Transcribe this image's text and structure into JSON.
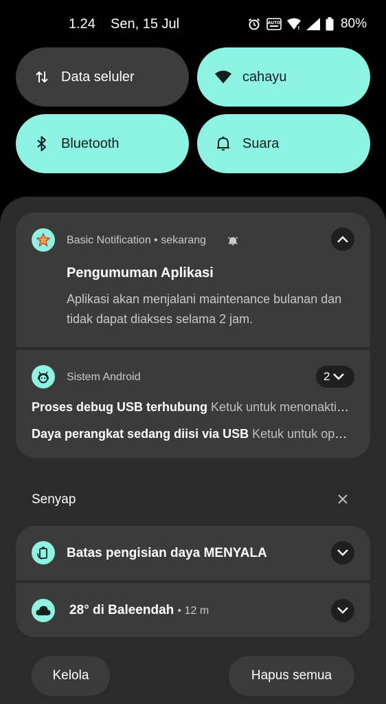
{
  "status_bar": {
    "time": "1.24",
    "date": "Sen, 15 Jul",
    "battery": "80%",
    "icons": [
      "alarm-icon",
      "auto-icon",
      "wifi-icon",
      "signal-icon",
      "battery-icon"
    ]
  },
  "quick_tiles": [
    {
      "label": "Data seluler",
      "icon": "data-arrows-icon",
      "state": "off"
    },
    {
      "label": "cahayu",
      "icon": "wifi-icon",
      "state": "on"
    },
    {
      "label": "Bluetooth",
      "icon": "bluetooth-icon",
      "state": "on"
    },
    {
      "label": "Suara",
      "icon": "bell-icon",
      "state": "on"
    }
  ],
  "notifications": [
    {
      "app": "Basic Notification",
      "time": "sekarang",
      "title": "Pengumuman Aplikasi",
      "body": "Aplikasi akan menjalani maintenance bulanan dan tidak dapat diakses selama 2 jam."
    },
    {
      "app": "Sistem Android",
      "count": "2",
      "lines": [
        {
          "title": "Proses debug USB terhubung",
          "text": "Ketuk untuk menonaktifkan proses debug USB"
        },
        {
          "title": "Daya perangkat sedang diisi via USB",
          "text": "Ketuk untuk opsi lainnya"
        }
      ]
    }
  ],
  "silent_section": {
    "label": "Senyap",
    "items": [
      {
        "title": "Batas pengisian daya MENYALA"
      },
      {
        "title": "28° di Baleendah",
        "time": "12 m"
      }
    ]
  },
  "footer": {
    "manage": "Kelola",
    "clear_all": "Hapus semua"
  },
  "colors": {
    "accent": "#8ef2e2",
    "card": "#3b3b3b",
    "shade": "#2b2b2b",
    "tile_off": "#3c3c3c"
  }
}
